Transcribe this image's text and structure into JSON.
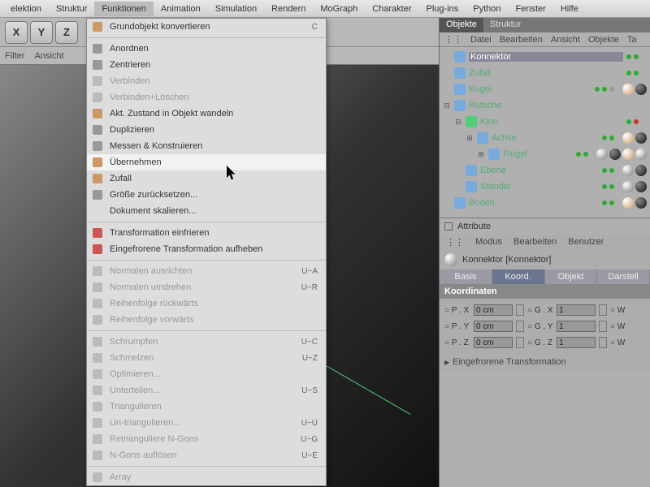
{
  "menubar": [
    "elektion",
    "Struktur",
    "Funktionen",
    "Animation",
    "Simulation",
    "Rendern",
    "MoGraph",
    "Charakter",
    "Plug-ins",
    "Python",
    "Fenster",
    "Hilfe"
  ],
  "menubar_active": 2,
  "axis_buttons": [
    "X",
    "Y",
    "Z"
  ],
  "tool_tabs": [
    "Filter",
    "Ansicht"
  ],
  "dropdown": [
    {
      "label": "Grundobjekt konvertieren",
      "shortcut": "C",
      "icon": "#c96"
    },
    {
      "sep": true
    },
    {
      "label": "Anordnen",
      "icon": "#999"
    },
    {
      "label": "Zentrieren",
      "icon": "#999"
    },
    {
      "label": "Verbinden",
      "disabled": true,
      "icon": "#bbb"
    },
    {
      "label": "Verbinden+Löschen",
      "disabled": true,
      "icon": "#bbb"
    },
    {
      "label": "Akt. Zustand in Objekt wandeln",
      "icon": "#c96"
    },
    {
      "label": "Duplizieren",
      "icon": "#999"
    },
    {
      "label": "Messen & Konstruieren",
      "icon": "#999"
    },
    {
      "label": "Übernehmen",
      "hover": true,
      "icon": "#c96"
    },
    {
      "label": "Zufall",
      "icon": "#c96"
    },
    {
      "label": "Größe zurücksetzen...",
      "icon": "#999"
    },
    {
      "label": "Dokument skalieren...",
      "icon": ""
    },
    {
      "sep": true
    },
    {
      "label": "Transformation einfrieren",
      "icon": "#c55"
    },
    {
      "label": "Eingefrorene Transformation aufheben",
      "icon": "#c55"
    },
    {
      "sep": true
    },
    {
      "label": "Normalen ausrichten",
      "shortcut": "U~A",
      "disabled": true,
      "icon": "#bbb"
    },
    {
      "label": "Normalen umdrehen",
      "shortcut": "U~R",
      "disabled": true,
      "icon": "#bbb"
    },
    {
      "label": "Reihenfolge rückwärts",
      "disabled": true,
      "icon": "#bbb"
    },
    {
      "label": "Reihenfolge vorwärts",
      "disabled": true,
      "icon": "#bbb"
    },
    {
      "sep": true
    },
    {
      "label": "Schrumpfen",
      "shortcut": "U~C",
      "disabled": true,
      "icon": "#bbb"
    },
    {
      "label": "Schmelzen",
      "shortcut": "U~Z",
      "disabled": true,
      "icon": "#bbb"
    },
    {
      "label": "Optimieren...",
      "disabled": true,
      "icon": "#bbb"
    },
    {
      "label": "Unterteilen...",
      "shortcut": "U~S",
      "disabled": true,
      "icon": "#bbb"
    },
    {
      "label": "Triangulieren",
      "disabled": true,
      "icon": "#bbb"
    },
    {
      "label": "Un-triangulieren...",
      "shortcut": "U~U",
      "disabled": true,
      "icon": "#bbb"
    },
    {
      "label": "Retrianguliere N-Gons",
      "shortcut": "U~G",
      "disabled": true,
      "icon": "#bbb"
    },
    {
      "label": "N-Gons auflösen",
      "shortcut": "U~E",
      "disabled": true,
      "icon": "#bbb"
    },
    {
      "sep": true
    },
    {
      "label": "Array",
      "disabled": true,
      "icon": "#bbb"
    }
  ],
  "obj_panel": {
    "tabs": [
      "Objekte",
      "Struktur"
    ],
    "menubar": [
      "Datei",
      "Bearbeiten",
      "Ansicht",
      "Objekte",
      "Ta"
    ],
    "tree": [
      {
        "indent": 0,
        "name": "Konnektor",
        "ic": "#7ad",
        "sel": true,
        "exp": "",
        "dots": [
          "green",
          "green"
        ],
        "balls": []
      },
      {
        "indent": 0,
        "name": "Zufall",
        "ic": "#7ad",
        "exp": "",
        "dots": [
          "green",
          "green"
        ],
        "balls": []
      },
      {
        "indent": 0,
        "name": "Kugel",
        "ic": "#7ad",
        "exp": "",
        "dots": [
          "green",
          "green",
          "gray"
        ],
        "balls": [
          "gold",
          "dark"
        ]
      },
      {
        "indent": 0,
        "name": "Rutsche",
        "ic": "#7ad",
        "exp": "⊟",
        "dots": [],
        "balls": []
      },
      {
        "indent": 1,
        "name": "Klon",
        "ic": "#5c7",
        "exp": "⊟",
        "dots": [
          "green",
          "red"
        ],
        "balls": []
      },
      {
        "indent": 2,
        "name": "Achse",
        "ic": "#7ad",
        "exp": "⊞",
        "dots": [
          "green",
          "green"
        ],
        "balls": [
          "gold",
          "dark"
        ]
      },
      {
        "indent": 3,
        "name": "Flügel",
        "ic": "#7ad",
        "exp": "⊞",
        "dots": [
          "green",
          "green"
        ],
        "balls": [
          "",
          "dark",
          "gold",
          ""
        ]
      },
      {
        "indent": 1,
        "name": "Ebene",
        "ic": "#7ad",
        "exp": "",
        "dots": [
          "green",
          "green"
        ],
        "balls": [
          "",
          "dark"
        ]
      },
      {
        "indent": 1,
        "name": "Ständer",
        "ic": "#7ad",
        "exp": "",
        "dots": [
          "green",
          "green"
        ],
        "balls": [
          "",
          "dark"
        ]
      },
      {
        "indent": 0,
        "name": "Boden",
        "ic": "#7ad",
        "exp": "",
        "dots": [
          "green",
          "green"
        ],
        "balls": [
          "gold",
          "dark"
        ]
      }
    ]
  },
  "attr": {
    "title": "Attribute",
    "menubar": [
      "Modus",
      "Bearbeiten",
      "Benutzer"
    ],
    "object": "Konnektor [Konnektor]",
    "tabs": [
      "Basis",
      "Koord.",
      "Objekt",
      "Darstell"
    ],
    "active_tab": 1,
    "section": "Koordinaten",
    "rows": [
      {
        "l1": "P . X",
        "v1": "0 cm",
        "l2": "G . X",
        "v2": "1",
        "l3": "W"
      },
      {
        "l1": "P . Y",
        "v1": "0 cm",
        "l2": "G . Y",
        "v2": "1",
        "l3": "W"
      },
      {
        "l1": "P . Z",
        "v1": "0 cm",
        "l2": "G . Z",
        "v2": "1",
        "l3": "W"
      }
    ],
    "frozen": "Eingefrorene Transformation"
  }
}
